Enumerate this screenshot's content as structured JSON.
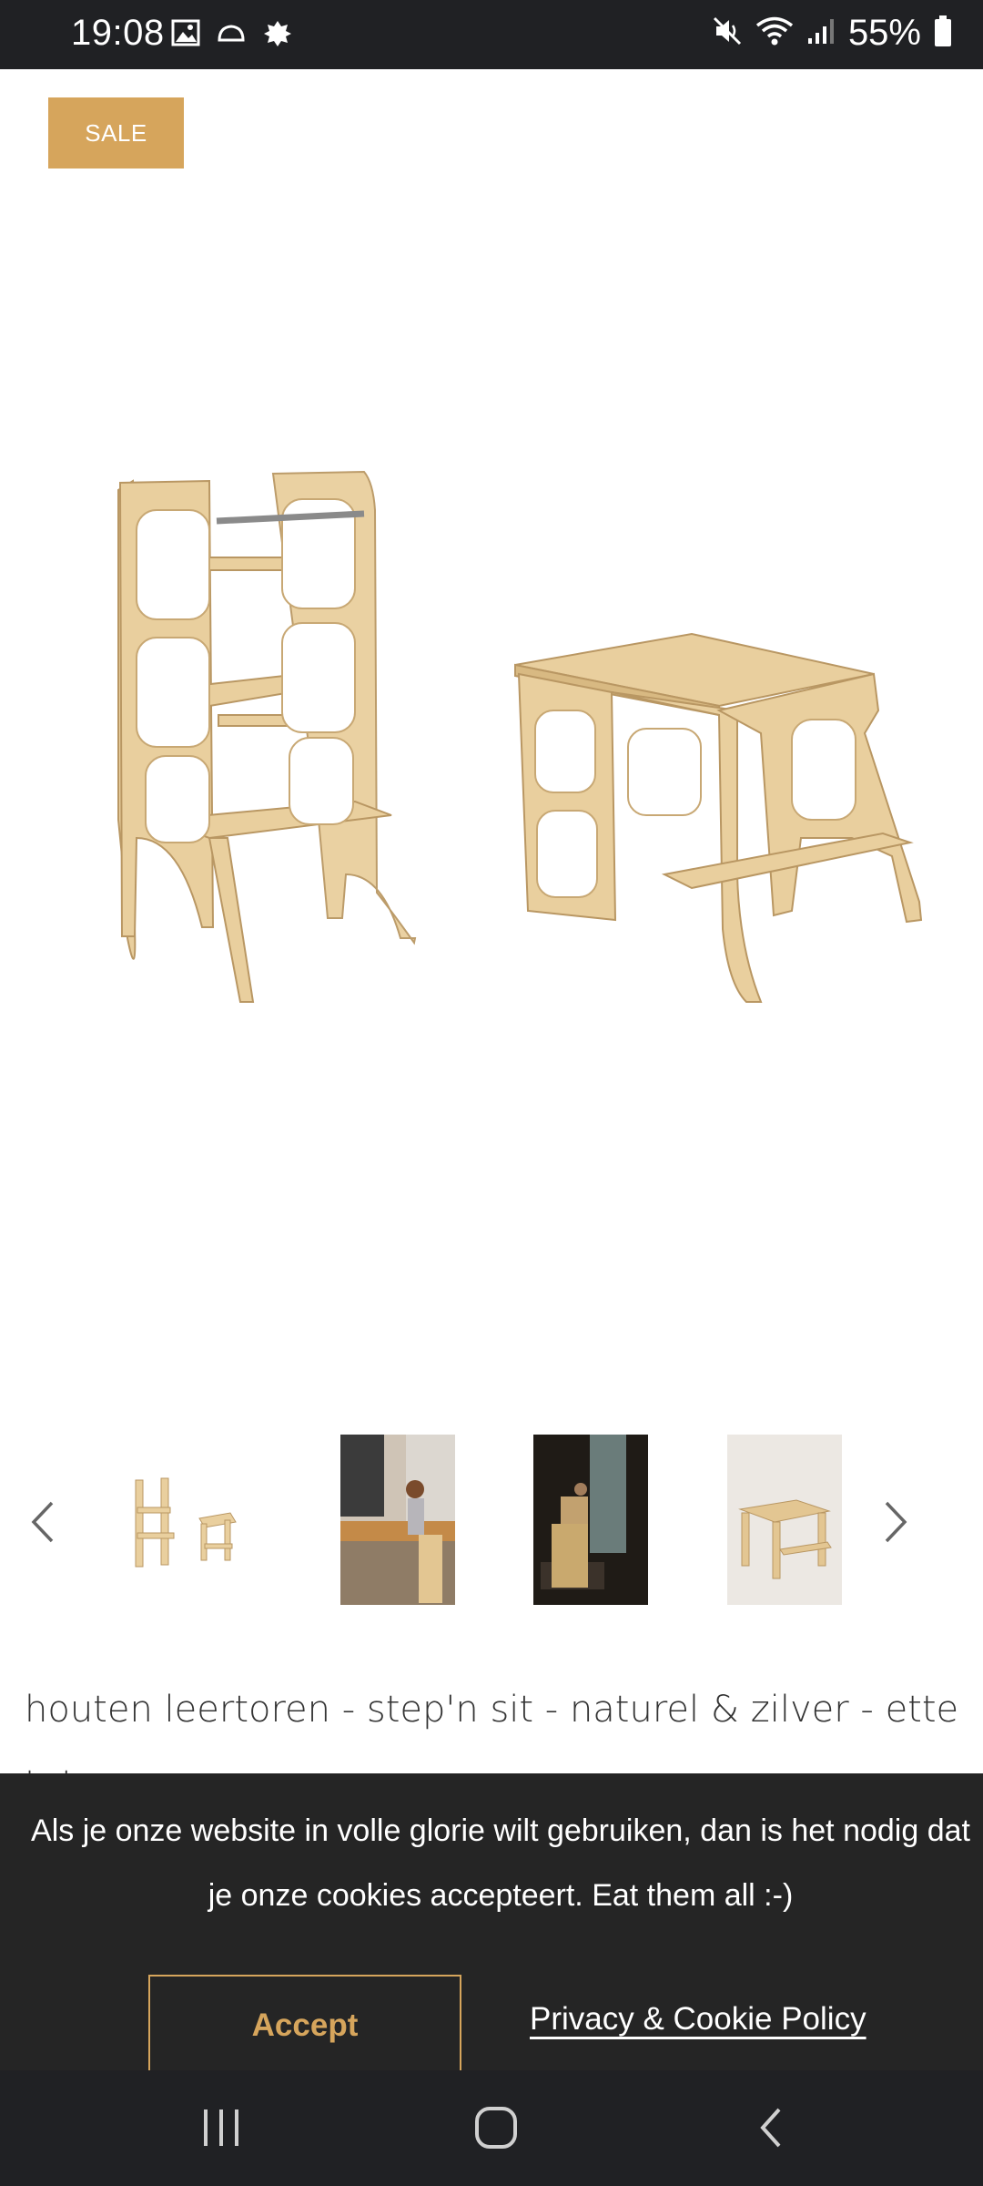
{
  "status_bar": {
    "time": "19:08",
    "battery": "55%",
    "left_icons": [
      "gallery-icon",
      "cloud-icon",
      "leaf-icon"
    ],
    "right_icons": [
      "mute-icon",
      "wifi-icon",
      "signal-icon",
      "battery-icon"
    ]
  },
  "product": {
    "badge": "SALE",
    "title": "houten leertoren - step'n sit - naturel & zilver - ette tete",
    "thumbnails": [
      "thumbnail-1",
      "thumbnail-2",
      "thumbnail-3",
      "thumbnail-4"
    ]
  },
  "cookie": {
    "text": "Als je onze website in volle glorie wilt gebruiken, dan is het nodig dat je onze cookies accepteert. Eat them all :-)",
    "accept_label": "Accept",
    "privacy_label": "Privacy & Cookie Policy"
  },
  "colors": {
    "accent": "#d6a55c",
    "banner": "#252525",
    "system_bar": "#202124"
  }
}
